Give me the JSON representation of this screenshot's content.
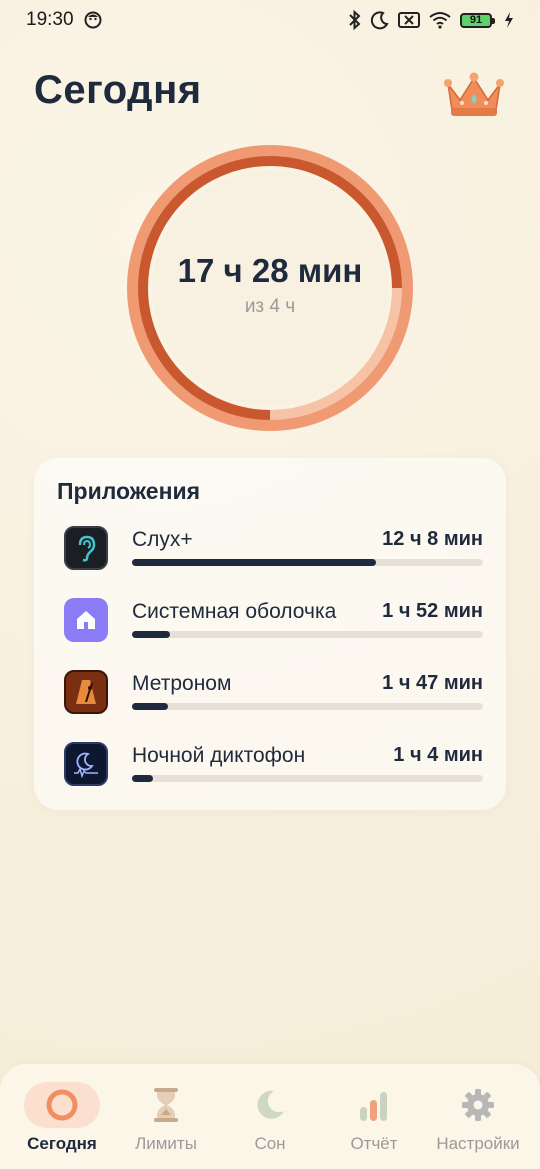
{
  "status_bar": {
    "time": "19:30",
    "battery_level": "91",
    "icons": [
      "face-icon",
      "bluetooth-icon",
      "moon-icon",
      "sim-off-icon",
      "wifi-icon",
      "battery-icon",
      "charging-icon"
    ]
  },
  "header": {
    "title": "Сегодня",
    "premium_icon": "crown-icon"
  },
  "summary": {
    "total_label": "17 ч 28 мин",
    "goal_label": "из 4 ч",
    "ring_colors": {
      "outer": "#ef9a72",
      "inner": "#c9582f",
      "light": "#f6c3a7"
    }
  },
  "apps": {
    "title": "Приложения",
    "items": [
      {
        "name": "Слух+",
        "time": "12 ч 8 мин",
        "fraction": 0.694,
        "icon": "ear-icon"
      },
      {
        "name": "Системная оболочка",
        "time": "1 ч 52 мин",
        "fraction": 0.107,
        "icon": "home-icon"
      },
      {
        "name": "Метроном",
        "time": "1 ч 47 мин",
        "fraction": 0.102,
        "icon": "metronome-icon"
      },
      {
        "name": "Ночной диктофон",
        "time": "1 ч 4 мин",
        "fraction": 0.061,
        "icon": "moon-recorder-icon"
      }
    ]
  },
  "nav": {
    "items": [
      {
        "label": "Сегодня",
        "icon": "ring-icon",
        "active": true
      },
      {
        "label": "Лимиты",
        "icon": "hourglass-icon",
        "active": false
      },
      {
        "label": "Сон",
        "icon": "moon-icon",
        "active": false
      },
      {
        "label": "Отчёт",
        "icon": "bar-chart-icon",
        "active": false
      },
      {
        "label": "Настройки",
        "icon": "gear-icon",
        "active": false
      }
    ]
  }
}
